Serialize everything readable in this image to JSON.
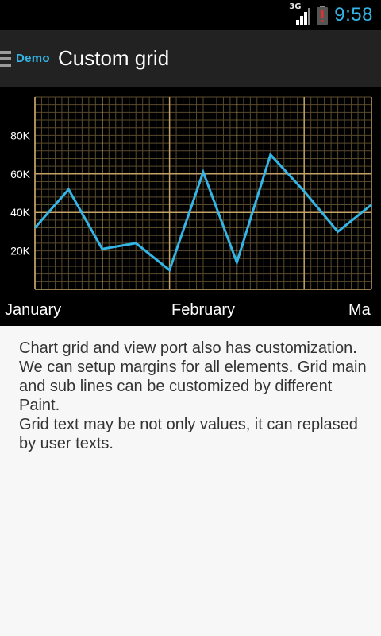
{
  "status_bar": {
    "network_label": "3G",
    "time": "9:58",
    "icons": [
      "signal-icon",
      "battery-alert-icon"
    ]
  },
  "action_bar": {
    "logo_text": "Demo",
    "title": "Custom grid"
  },
  "chart_data": {
    "type": "line",
    "series": [
      {
        "values": [
          32000,
          52000,
          21000,
          24000,
          10000,
          61000,
          14000,
          70000,
          51000,
          30000,
          44000
        ]
      }
    ],
    "x_labels": [
      "January",
      "February",
      "Ma"
    ],
    "y_tick_labels": [
      "20K",
      "40K",
      "60K",
      "80K"
    ],
    "ylim": [
      0,
      100000
    ],
    "grid": true,
    "colors": {
      "line": "#33b5e5",
      "grid_main": "#c2a265",
      "grid_sub": "#5a4a2c",
      "background": "#000000",
      "text": "#ffffff"
    }
  },
  "description": {
    "line1": "Chart grid and view port also has customization. We can setup margins for all elements. Grid main and sub lines can be customized by different Paint.",
    "line2": "Grid text may be not only values, it can replased by user texts."
  }
}
